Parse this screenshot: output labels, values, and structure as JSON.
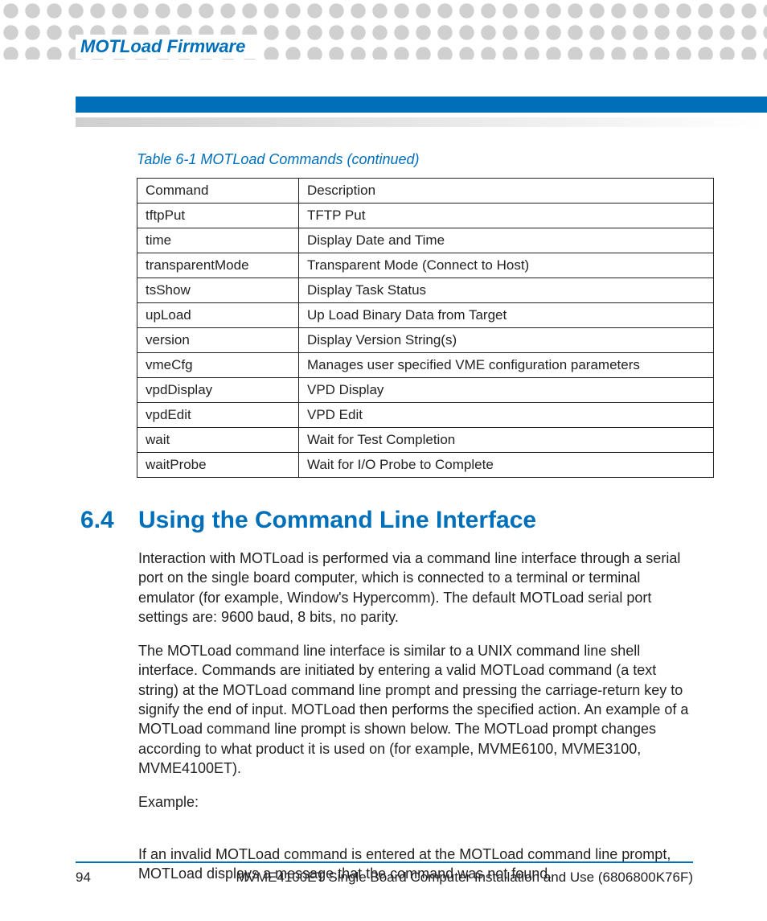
{
  "header": {
    "chapter": "MOTLoad Firmware"
  },
  "table": {
    "caption": "Table 6-1 MOTLoad Commands (continued)",
    "head": {
      "c1": "Command",
      "c2": "Description"
    },
    "rows": [
      {
        "c1": "tftpPut",
        "c2": "TFTP Put"
      },
      {
        "c1": "time",
        "c2": "Display Date and Time"
      },
      {
        "c1": "transparentMode",
        "c2": "Transparent Mode (Connect to Host)"
      },
      {
        "c1": "tsShow",
        "c2": "Display Task Status"
      },
      {
        "c1": "upLoad",
        "c2": "Up Load Binary Data from Target"
      },
      {
        "c1": "version",
        "c2": "Display Version String(s)"
      },
      {
        "c1": "vmeCfg",
        "c2": "Manages user specified VME configuration parameters"
      },
      {
        "c1": "vpdDisplay",
        "c2": "VPD Display"
      },
      {
        "c1": "vpdEdit",
        "c2": "VPD Edit"
      },
      {
        "c1": "wait",
        "c2": "Wait for Test Completion"
      },
      {
        "c1": "waitProbe",
        "c2": "Wait for I/O Probe to Complete"
      }
    ]
  },
  "section": {
    "number": "6.4",
    "title": "Using the Command Line Interface",
    "p1": "Interaction with MOTLoad is performed via a command line interface through a serial port on the single board computer, which is connected to a terminal or terminal emulator (for example, Window's Hypercomm). The default MOTLoad serial port settings are: 9600 baud, 8 bits, no parity.",
    "p2": "The MOTLoad command line interface is similar to a UNIX command line shell interface. Commands are initiated by entering a valid MOTLoad command (a text string) at the MOTLoad command line prompt and pressing the carriage-return key to signify the end of input. MOTLoad then performs the specified action. An example of a MOTLoad command line prompt is shown below. The MOTLoad prompt changes according to what product it is used on (for example, MVME6100, MVME3100, MVME4100ET).",
    "p3": "Example:",
    "p4": "If an invalid MOTLoad command is entered at the MOTLoad command line prompt, MOTLoad displays a message that the command was not found."
  },
  "footer": {
    "page": "94",
    "doc": "MVME4100ET Single Board Computer Installation and Use (6806800K76F)"
  }
}
